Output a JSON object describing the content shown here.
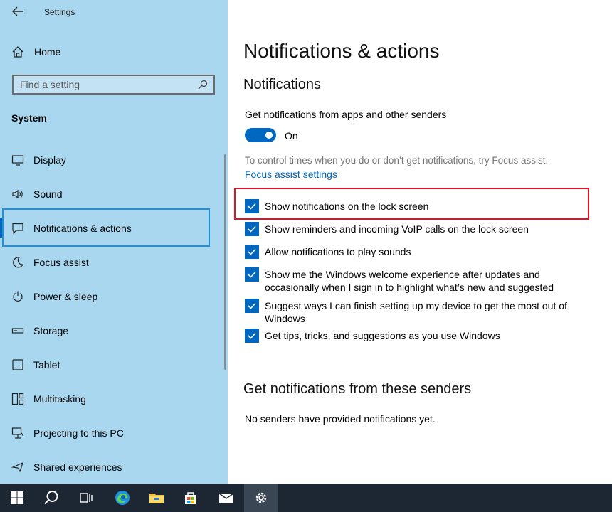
{
  "window": {
    "title": "Settings"
  },
  "sidebar": {
    "home_label": "Home",
    "search_placeholder": "Find a setting",
    "section": "System",
    "items": [
      {
        "label": "Display",
        "icon": "monitor-icon"
      },
      {
        "label": "Sound",
        "icon": "speaker-icon"
      },
      {
        "label": "Notifications & actions",
        "icon": "chat-icon",
        "selected": true
      },
      {
        "label": "Focus assist",
        "icon": "moon-icon"
      },
      {
        "label": "Power & sleep",
        "icon": "power-icon"
      },
      {
        "label": "Storage",
        "icon": "drive-icon"
      },
      {
        "label": "Tablet",
        "icon": "tablet-icon"
      },
      {
        "label": "Multitasking",
        "icon": "multitask-icon"
      },
      {
        "label": "Projecting to this PC",
        "icon": "project-icon"
      },
      {
        "label": "Shared experiences",
        "icon": "share-icon"
      }
    ]
  },
  "main": {
    "title": "Notifications & actions",
    "subtitle": "Notifications",
    "get_notifications_label": "Get notifications from apps and other senders",
    "toggle_state": "On",
    "focus_hint": "To control times when you do or don’t get notifications, try Focus assist.",
    "focus_link": "Focus assist settings",
    "checkboxes": [
      {
        "label": "Show notifications on the lock screen",
        "checked": true
      },
      {
        "label": "Show reminders and incoming VoIP calls on the lock screen",
        "checked": true
      },
      {
        "label": "Allow notifications to play sounds",
        "checked": true
      },
      {
        "label": "Show me the Windows welcome experience after updates and occasionally when I sign in to highlight what’s new and suggested",
        "checked": true
      },
      {
        "label": "Suggest ways I can finish setting up my device to get the most out of Windows",
        "checked": true
      },
      {
        "label": "Get tips, tricks, and suggestions as you use Windows",
        "checked": true
      }
    ],
    "senders_heading": "Get notifications from these senders",
    "senders_empty": "No senders have provided notifications yet."
  },
  "taskbar": {
    "items": [
      "start-icon",
      "search-icon",
      "task-view-icon",
      "edge-icon",
      "file-explorer-icon",
      "store-icon",
      "mail-icon",
      "settings-icon"
    ],
    "active": "settings-icon"
  },
  "colors": {
    "accent": "#0067c0",
    "sidebar_bg": "#a9d7ef",
    "highlight": "#e81123",
    "taskbar": "#1c2733"
  }
}
